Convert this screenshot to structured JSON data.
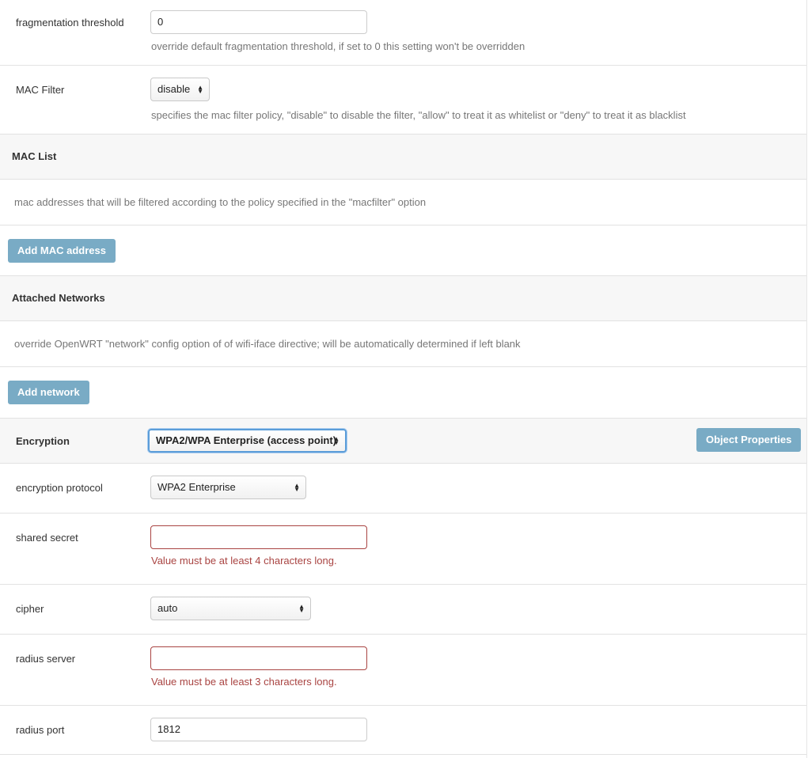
{
  "fragmentation": {
    "label": "fragmentation threshold",
    "value": "0",
    "help": "override default fragmentation threshold, if set to 0 this setting won't be overridden"
  },
  "mac_filter": {
    "label": "MAC Filter",
    "value": "disable",
    "help": "specifies the mac filter policy, \"disable\" to disable the filter, \"allow\" to treat it as whitelist or \"deny\" to treat it as blacklist"
  },
  "mac_list": {
    "header": "MAC List",
    "help": "mac addresses that will be filtered according to the policy specified in the \"macfilter\" option",
    "add_label": "Add MAC address"
  },
  "attached_networks": {
    "header": "Attached Networks",
    "help": "override OpenWRT \"network\" config option of of wifi-iface directive; will be automatically determined if left blank",
    "add_label": "Add network"
  },
  "encryption": {
    "label": "Encryption",
    "value": "WPA2/WPA Enterprise (access point)",
    "props_label": "Object Properties"
  },
  "encryption_protocol": {
    "label": "encryption protocol",
    "value": "WPA2 Enterprise"
  },
  "shared_secret": {
    "label": "shared secret",
    "value": "",
    "error": "Value must be at least 4 characters long."
  },
  "cipher": {
    "label": "cipher",
    "value": "auto"
  },
  "radius_server": {
    "label": "radius server",
    "value": "",
    "error": "Value must be at least 3 characters long."
  },
  "radius_port": {
    "label": "radius port",
    "value": "1812"
  },
  "colors": {
    "button": "#79abc5",
    "error": "#a94442",
    "focus": "#5b9dd9",
    "section_bg": "#f7f7f7"
  }
}
